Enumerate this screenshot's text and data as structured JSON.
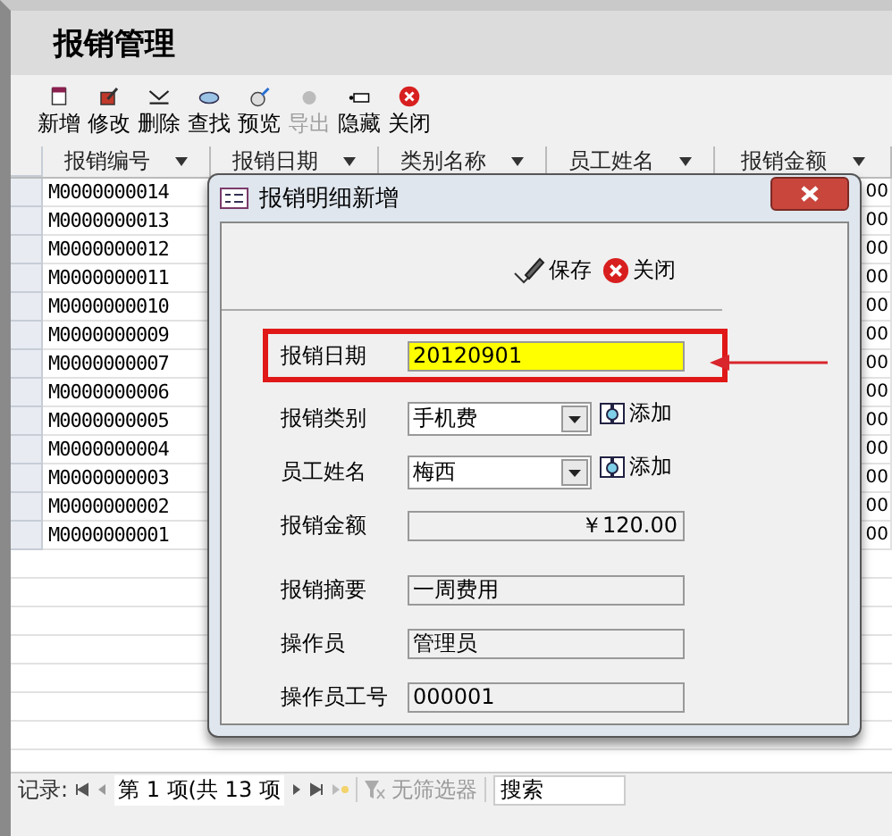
{
  "app_title": "报销管理",
  "toolbar": [
    {
      "label": "新增",
      "disabled": false
    },
    {
      "label": "修改",
      "disabled": false
    },
    {
      "label": "删除",
      "disabled": false
    },
    {
      "label": "查找",
      "disabled": false
    },
    {
      "label": "预览",
      "disabled": false
    },
    {
      "label": "导出",
      "disabled": true
    },
    {
      "label": "隐藏",
      "disabled": false
    },
    {
      "label": "关闭",
      "disabled": false
    }
  ],
  "grid": {
    "columns": [
      "报销编号",
      "报销日期",
      "类别名称",
      "员工姓名",
      "报销金额"
    ],
    "rows": [
      {
        "id": "M0000000014",
        "amount_tail": "00"
      },
      {
        "id": "M0000000013",
        "amount_tail": "00"
      },
      {
        "id": "M0000000012",
        "amount_tail": "00"
      },
      {
        "id": "M0000000011",
        "amount_tail": "00"
      },
      {
        "id": "M0000000010",
        "amount_tail": "00"
      },
      {
        "id": "M0000000009",
        "amount_tail": "00"
      },
      {
        "id": "M0000000007",
        "amount_tail": "00"
      },
      {
        "id": "M0000000006",
        "amount_tail": "00"
      },
      {
        "id": "M0000000005",
        "amount_tail": "00"
      },
      {
        "id": "M0000000004",
        "amount_tail": "00"
      },
      {
        "id": "M0000000003",
        "amount_tail": "00"
      },
      {
        "id": "M0000000002",
        "amount_tail": "00"
      },
      {
        "id": "M0000000001",
        "amount_tail": "00"
      }
    ]
  },
  "dialog": {
    "title": "报销明细新增",
    "actions": [
      {
        "label": "保存",
        "kind": "save"
      },
      {
        "label": "关闭",
        "kind": "close"
      }
    ],
    "fields": [
      {
        "label": "报销日期",
        "value": "20120901",
        "kind": "text",
        "highlighted": true
      },
      {
        "label": "报销类别",
        "value": "手机费",
        "kind": "combo",
        "add_label": "添加",
        "highlighted": false
      },
      {
        "label": "员工姓名",
        "value": "梅西",
        "kind": "combo",
        "add_label": "添加",
        "highlighted": false
      },
      {
        "label": "报销金额",
        "value": "￥120.00",
        "kind": "amount",
        "highlighted": false
      },
      {
        "label": "报销摘要",
        "value": "一周费用",
        "kind": "text",
        "highlighted": false
      },
      {
        "label": "操作员",
        "value": "管理员",
        "kind": "text",
        "highlighted": false
      },
      {
        "label": "操作员工号",
        "value": "000001",
        "kind": "text",
        "highlighted": false
      }
    ]
  },
  "status_bar": {
    "label": "记录:",
    "position": "第 1 项(共 13 项",
    "filter": "无筛选器",
    "search_placeholder": "搜索"
  }
}
